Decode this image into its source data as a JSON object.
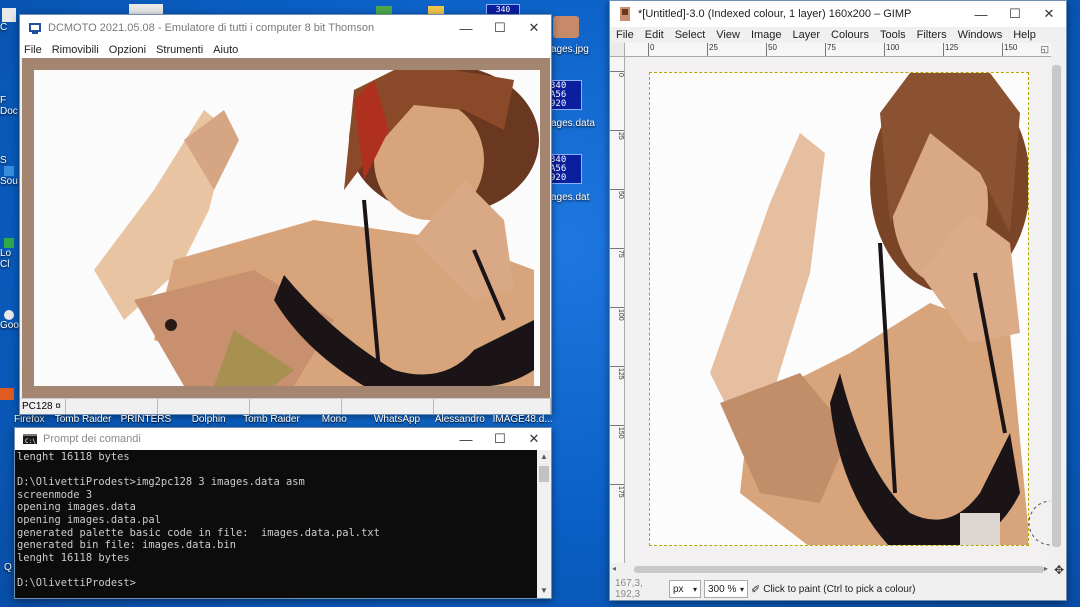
{
  "desktop": {
    "left_icons": [
      "C",
      "F",
      "Doc",
      "S",
      "Sou",
      "Lo",
      "Cl",
      "Goo",
      "Q"
    ],
    "bottom_left": "Firefox",
    "top_right_label_1": "ages.jpg",
    "top_right_label_2": "ages.data",
    "top_right_label_3": "ages.dat",
    "tile_1": [
      "340",
      "A56",
      "920"
    ],
    "tile_2": [
      "340",
      "A56",
      "920"
    ],
    "tile_3": [
      "340",
      "A56",
      "920"
    ]
  },
  "dcmoto": {
    "title": "DCMOTO 2021.05.08 - Emulatore di tutti i computer 8 bit Thomson",
    "menu": [
      "File",
      "Rimovibili",
      "Opzioni",
      "Strumenti",
      "Aiuto"
    ],
    "status": "PC128 ¤"
  },
  "taskbar_strip": [
    "Tomb Raider",
    "PRINTERS",
    "Dolphin",
    "Tomb Raider",
    "Mono",
    "WhatsApp",
    "Alessandro",
    "IMAGE48.d..."
  ],
  "cmd": {
    "title": "Prompt dei comandi",
    "lines": [
      "lenght 16118 bytes",
      "",
      "D:\\OlivettiProdest>img2pc128 3 images.data asm",
      "screenmode 3",
      "opening images.data",
      "opening images.data.pal",
      "generated palette basic code in file:  images.data.pal.txt",
      "generated bin file: images.data.bin",
      "lenght 16118 bytes",
      "",
      "D:\\OlivettiProdest>"
    ]
  },
  "gimp": {
    "title": "*[Untitled]-3.0 (Indexed colour, 1 layer) 160x200 – GIMP",
    "menu": [
      "File",
      "Edit",
      "Select",
      "View",
      "Image",
      "Layer",
      "Colours",
      "Tools",
      "Filters",
      "Windows",
      "Help"
    ],
    "hruler_labels": [
      "0",
      "25",
      "50",
      "75",
      "100",
      "125",
      "150"
    ],
    "vruler_labels": [
      "0",
      "25",
      "50",
      "75",
      "100",
      "125",
      "150",
      "175"
    ],
    "coords": "167,3, 192,3",
    "unit": "px",
    "zoom": "300 %",
    "status_text": "Click to paint (Ctrl to pick a colour)"
  },
  "colors": {
    "desktop": "#0a5fc4",
    "dcmoto_border": "#a38570",
    "skin": "#d8a880",
    "bra": "#1a1416",
    "hair": "#6a3820"
  }
}
